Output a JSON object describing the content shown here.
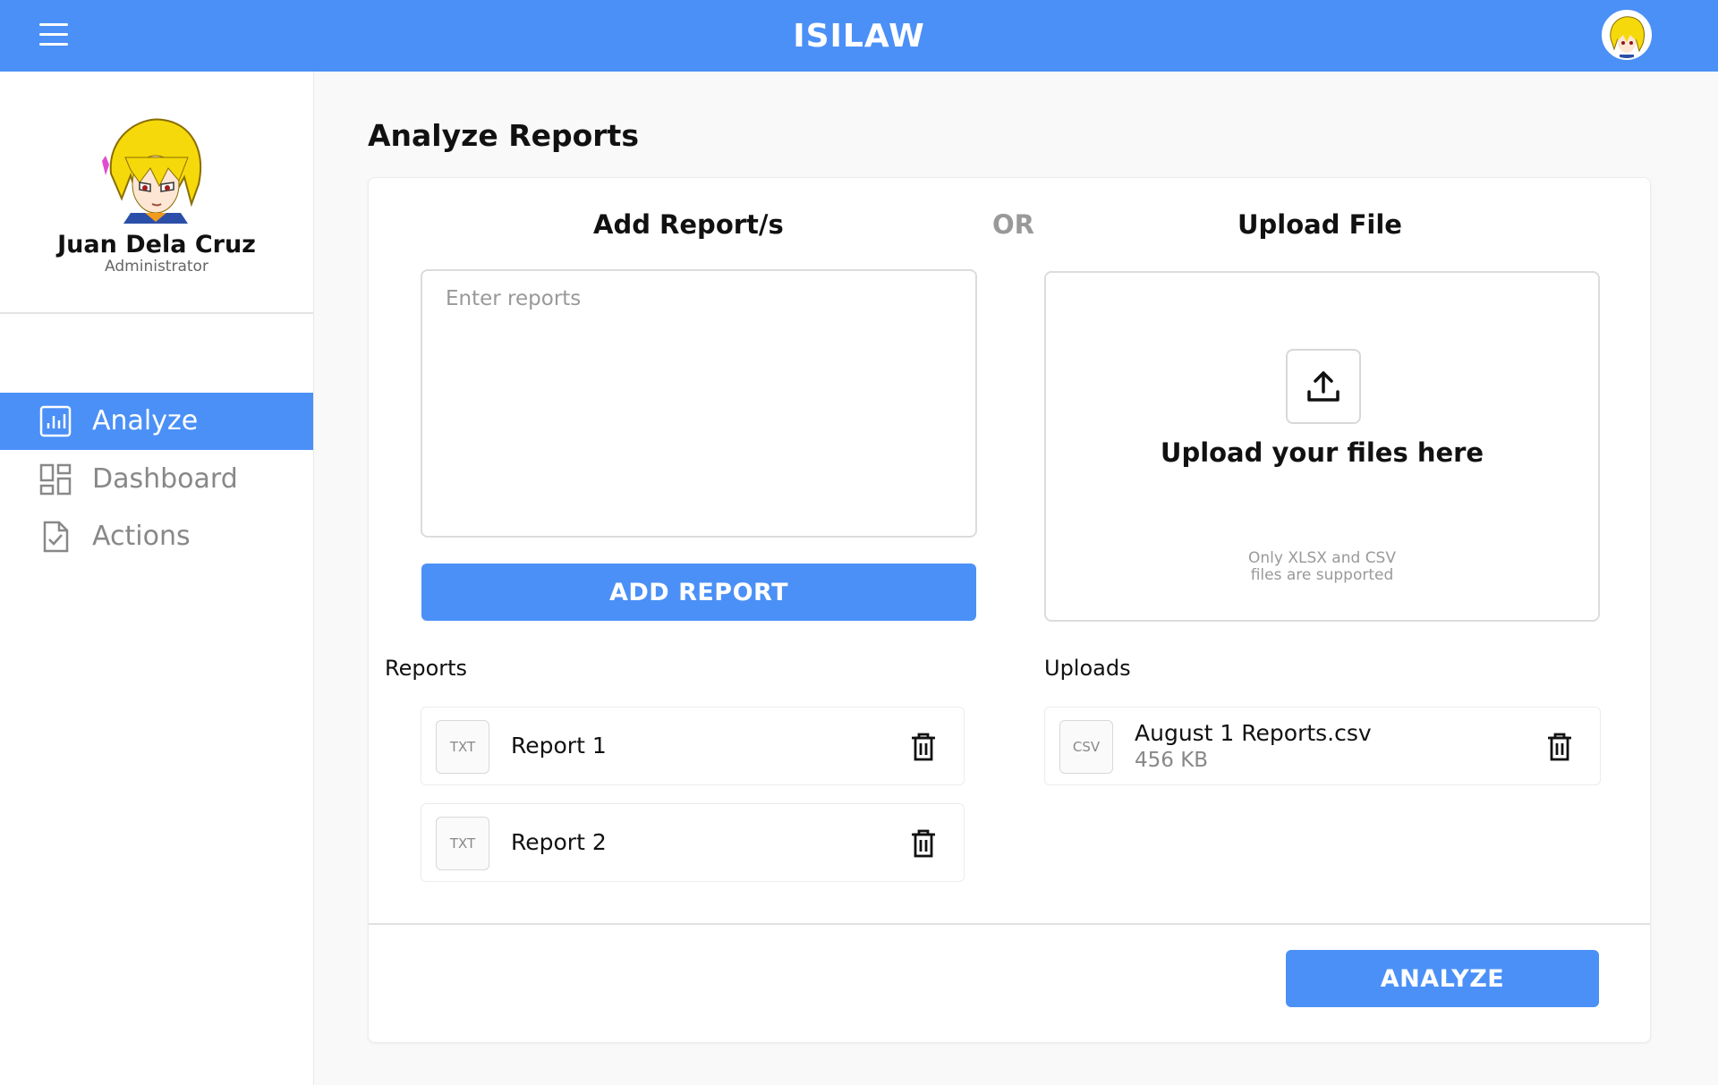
{
  "header": {
    "app_title": "ISILAW"
  },
  "profile": {
    "name": "Juan Dela Cruz",
    "role": "Administrator"
  },
  "nav": {
    "items": [
      {
        "label": "Analyze",
        "icon": "chart-icon",
        "active": true
      },
      {
        "label": "Dashboard",
        "icon": "dashboard-icon",
        "active": false
      },
      {
        "label": "Actions",
        "icon": "document-check-icon",
        "active": false
      }
    ]
  },
  "page": {
    "title": "Analyze Reports"
  },
  "add_reports": {
    "heading": "Add Report/s",
    "placeholder": "Enter reports",
    "value": "",
    "button_label": "ADD REPORT"
  },
  "separator": "OR",
  "upload": {
    "heading": "Upload File",
    "drop_title": "Upload your files here",
    "note_line1": "Only XLSX and CSV",
    "note_line2": "files are supported"
  },
  "reports": {
    "label": "Reports",
    "items": [
      {
        "type": "TXT",
        "name": "Report 1"
      },
      {
        "type": "TXT",
        "name": "Report 2"
      }
    ]
  },
  "uploads": {
    "label": "Uploads",
    "items": [
      {
        "type": "CSV",
        "name": "August 1 Reports.csv",
        "size": "456 KB"
      }
    ]
  },
  "analyze_button": "ANALYZE",
  "colors": {
    "accent": "#4b90f7",
    "muted_text": "#888888"
  }
}
